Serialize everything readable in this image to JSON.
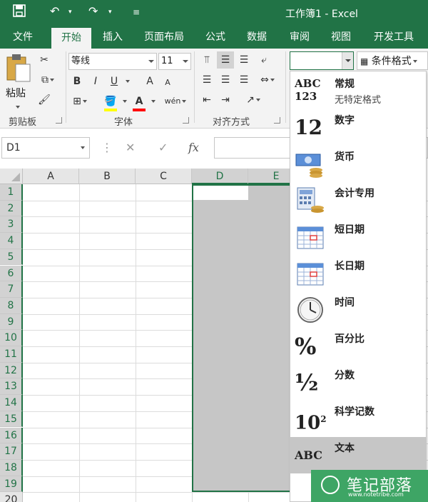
{
  "titlebar": {
    "title": "工作簿1 - Excel"
  },
  "tabs": [
    "文件",
    "开始",
    "插入",
    "页面布局",
    "公式",
    "数据",
    "审阅",
    "视图",
    "开发工具"
  ],
  "ribbon": {
    "paste_label": "粘贴",
    "font_name": "等线",
    "font_size": "11",
    "bold": "B",
    "italic": "I",
    "underline": "U",
    "font_grow": "A",
    "font_shrink": "A",
    "font_color_letter": "A",
    "phonetic": "wén",
    "conditional_format": "条件格式",
    "groups": {
      "clipboard": "剪贴板",
      "font": "字体",
      "alignment": "对齐方式"
    },
    "accent_yellow": "#ffff00",
    "accent_red": "#ff0000"
  },
  "formula_bar": {
    "name_box": "D1",
    "fx": "fx"
  },
  "grid": {
    "columns": [
      "A",
      "B",
      "C",
      "D",
      "E"
    ],
    "rows": [
      "1",
      "2",
      "3",
      "4",
      "5",
      "6",
      "7",
      "8",
      "9",
      "10",
      "11",
      "12",
      "13",
      "14",
      "15",
      "16",
      "17",
      "18",
      "19",
      "20"
    ],
    "selected_columns": [
      "D",
      "E"
    ],
    "active_cell": "D1",
    "selection_color": "#217346"
  },
  "number_format_menu": {
    "items": [
      {
        "label": "常规",
        "sub": "无特定格式",
        "icon": "ABC123",
        "icon_name": "general-format-icon"
      },
      {
        "label": "数字",
        "icon": "12",
        "icon_name": "number-format-icon"
      },
      {
        "label": "货币",
        "icon": "",
        "icon_name": "currency-format-icon"
      },
      {
        "label": "会计专用",
        "icon": "",
        "icon_name": "accounting-format-icon"
      },
      {
        "label": "短日期",
        "icon": "",
        "icon_name": "short-date-icon"
      },
      {
        "label": "长日期",
        "icon": "",
        "icon_name": "long-date-icon"
      },
      {
        "label": "时间",
        "icon": "",
        "icon_name": "clock-icon"
      },
      {
        "label": "百分比",
        "icon": "%",
        "icon_name": "percent-icon"
      },
      {
        "label": "分数",
        "icon": "½",
        "icon_name": "fraction-icon"
      },
      {
        "label": "科学记数",
        "icon": "10²",
        "icon_name": "scientific-icon"
      },
      {
        "label": "文本",
        "icon": "ABC",
        "icon_name": "text-format-icon"
      }
    ],
    "highlighted": "文本"
  },
  "watermark": {
    "text": "笔记部落",
    "url": "www.notetribe.com"
  },
  "colors": {
    "excel_green": "#217346"
  }
}
